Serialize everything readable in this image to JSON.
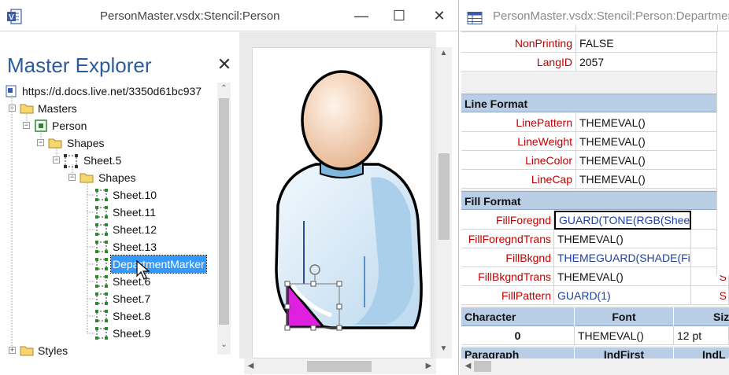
{
  "left_window": {
    "title": "PersonMaster.vsdx:Stencil:Person",
    "minimize": "—",
    "maximize": "☐",
    "close": "✕"
  },
  "explorer": {
    "title": "Master Explorer",
    "close": "✕",
    "root_url": "https://d.docs.live.net/3350d61bc937",
    "nodes": {
      "masters": "Masters",
      "person": "Person",
      "shapes1": "Shapes",
      "sheet5": "Sheet.5",
      "shapes2": "Shapes",
      "sheet10": "Sheet.10",
      "sheet11": "Sheet.11",
      "sheet12": "Sheet.12",
      "sheet13": "Sheet.13",
      "department_marker": "DepartmentMarker",
      "sheet6": "Sheet.6",
      "sheet7": "Sheet.7",
      "sheet8": "Sheet.8",
      "sheet9": "Sheet.9",
      "styles": "Styles"
    }
  },
  "right_window": {
    "title": "PersonMaster.vsdx:Stencil:Person:DepartmentMarker"
  },
  "shapesheet": {
    "top_rows": [
      {
        "name": "NonPrinting",
        "value": "FALSE"
      },
      {
        "name": "LangID",
        "value": "2057"
      }
    ],
    "line_format": {
      "title": "Line Format",
      "rows": [
        {
          "name": "LinePattern",
          "value": "THEMEVAL()"
        },
        {
          "name": "LineWeight",
          "value": "THEMEVAL()"
        },
        {
          "name": "LineColor",
          "value": "THEMEVAL()"
        },
        {
          "name": "LineCap",
          "value": "THEMEVAL()"
        }
      ]
    },
    "fill_format": {
      "title": "Fill Format",
      "rows": [
        {
          "name": "FillForegnd",
          "value": "GUARD(TONE(RGB(Sheet",
          "right": ""
        },
        {
          "name": "FillForegndTrans",
          "value": "THEMEVAL()",
          "right": "S"
        },
        {
          "name": "FillBkgnd",
          "value": "THEMEGUARD(SHADE(Fil",
          "right": ""
        },
        {
          "name": "FillBkgndTrans",
          "value": "THEMEVAL()",
          "right": "S"
        },
        {
          "name": "FillPattern",
          "value": "GUARD(1)",
          "right": "S"
        }
      ]
    },
    "character": {
      "headers": [
        "Character",
        "Font",
        "Siz"
      ],
      "row": [
        "0",
        "THEMEVAL()",
        "12 pt"
      ]
    },
    "paragraph": {
      "headers": [
        "Paragraph",
        "IndFirst",
        "IndL"
      ]
    }
  },
  "colors": {
    "accent": "#2e5c9a",
    "section_header": "#b9cde5",
    "cell_name": "#c00000",
    "selection": "#3399ff",
    "marker_fill": "#e020e0"
  }
}
